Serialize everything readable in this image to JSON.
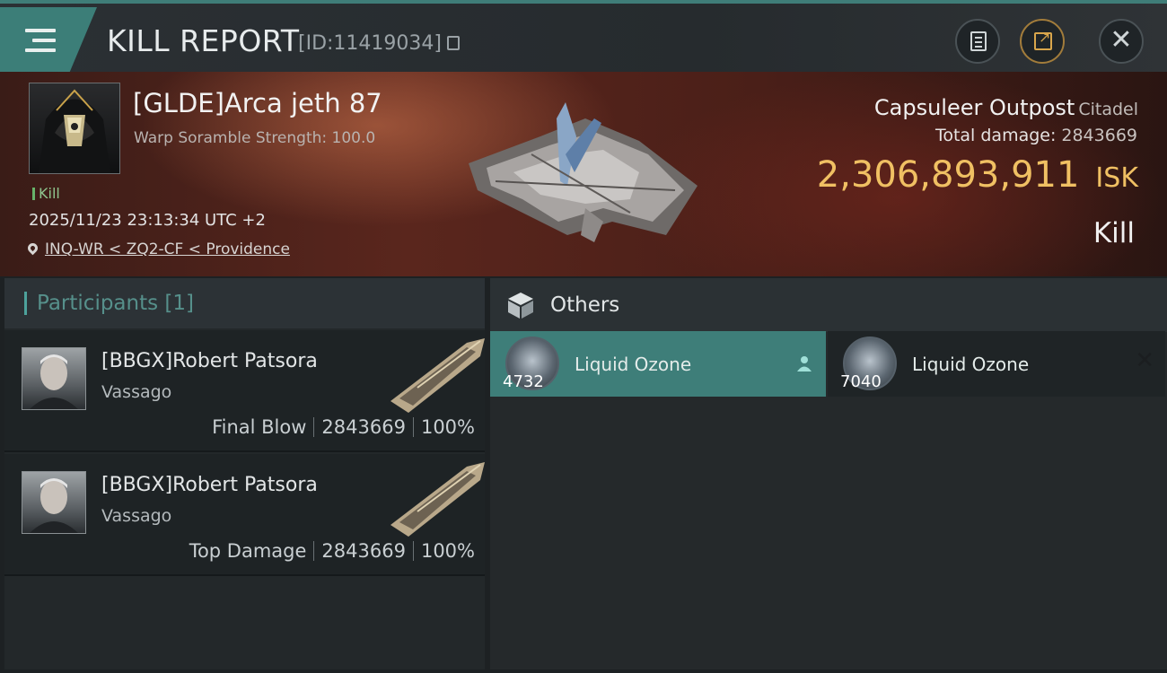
{
  "header": {
    "title": "KILL REPORT",
    "report_id": "[ID:11419034]"
  },
  "victim": {
    "pilot": "[GLDE]Arca jeth 87",
    "warp_scramble": "Warp Soramble Strength: 100.0",
    "result_tag": "Kill",
    "timestamp": "2025/11/23 23:13:34 UTC +2",
    "location": "INQ-WR < ZQ2-CF < Providence",
    "ship_name": "Capsuleer Outpost",
    "ship_class": "Citadel",
    "total_damage_label": "Total damage:",
    "total_damage_value": "2843669",
    "isk_value": "2,306,893,911",
    "isk_unit": "ISK",
    "kill_label": "Kill"
  },
  "participants": {
    "title": "Participants [1]",
    "rows": [
      {
        "name": "[BBGX]Robert Patsora",
        "ship": "Vassago",
        "role": "Final Blow",
        "damage": "2843669",
        "percent": "100%"
      },
      {
        "name": "[BBGX]Robert Patsora",
        "ship": "Vassago",
        "role": "Top Damage",
        "damage": "2843669",
        "percent": "100%"
      }
    ]
  },
  "others": {
    "title": "Others",
    "items": [
      {
        "name": "Liquid Ozone",
        "quantity": "4732",
        "state": "selected"
      },
      {
        "name": "Liquid Ozone",
        "quantity": "7040",
        "state": "unselected"
      }
    ]
  },
  "colors": {
    "accent_teal": "#3e7e79",
    "isk_gold": "#f0c063",
    "kill_green": "#67b36a"
  },
  "icons": [
    "menu-icon",
    "copy-icon",
    "clipboard-icon",
    "share-icon",
    "close-icon",
    "location-pin-icon",
    "cube-icon",
    "person-icon",
    "remove-icon"
  ]
}
